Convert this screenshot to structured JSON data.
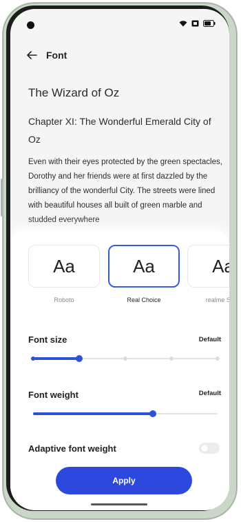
{
  "app_bar": {
    "title": "Font"
  },
  "preview": {
    "book_title": "The Wizard of Oz",
    "chapter_title": "Chapter XI: The Wonderful Emerald City of Oz",
    "paragraph": "Even with their eyes protected by the green spectacles, Dorothy and her friends were at first dazzled by the brilliancy of the wonderful City. The streets were lined with beautiful houses all built of green marble and studded everywhere"
  },
  "fonts": [
    {
      "sample": "Aa",
      "label": "Roboto",
      "selected": false
    },
    {
      "sample": "Aa",
      "label": "Real Choice",
      "selected": true
    },
    {
      "sample": "Aa",
      "label": "realme Sans",
      "selected": false
    }
  ],
  "font_size": {
    "label": "Font size",
    "value": "Default",
    "steps": 5,
    "selected_step": 2
  },
  "font_weight": {
    "label": "Font weight",
    "value": "Default",
    "level": 0.65
  },
  "adaptive_font_weight": {
    "label": "Adaptive font weight",
    "enabled": false
  },
  "apply_label": "Apply",
  "colors": {
    "accent": "#2d48dd",
    "selected_border": "#3a5bd9"
  },
  "icons": {
    "back": "arrow-left-icon",
    "wifi": "wifi-icon",
    "sim": "sim-icon",
    "battery": "battery-icon"
  }
}
